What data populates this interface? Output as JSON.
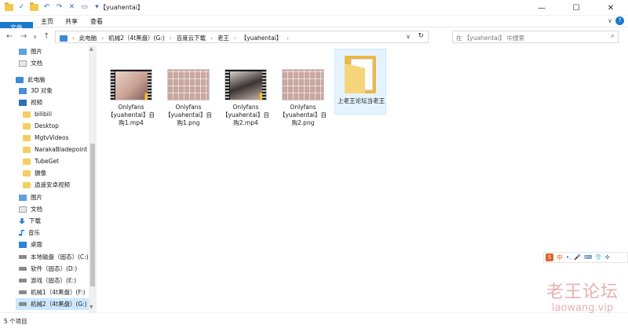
{
  "window": {
    "title": "【yuahentai】",
    "minimize": "—",
    "maximize": "☐",
    "close": "✕"
  },
  "ribbon": {
    "tabs": [
      "文件",
      "主页",
      "共享",
      "查看"
    ],
    "expand": "∨",
    "help": "?"
  },
  "address": {
    "crumbs": [
      "此电脑",
      "机械2（4t黑盘）(G:)",
      "百度云下载",
      "老王",
      "【yuahentai】"
    ],
    "search_placeholder": "在 【yuahentai】 中搜索"
  },
  "nav": {
    "items": [
      {
        "label": "图片",
        "icon": "picture-icon"
      },
      {
        "label": "文档",
        "icon": "document-icon"
      },
      {
        "label": "此电脑",
        "icon": "pc-icon"
      },
      {
        "label": "3D 对象",
        "icon": "3d-objects-icon"
      },
      {
        "label": "视频",
        "icon": "video-icon"
      },
      {
        "label": "bilibili",
        "icon": "folder-icon"
      },
      {
        "label": "Desktop",
        "icon": "folder-icon"
      },
      {
        "label": "MgtvVideos",
        "icon": "folder-icon"
      },
      {
        "label": "NarakaBladepoint",
        "icon": "folder-icon"
      },
      {
        "label": "TubeGet",
        "icon": "folder-icon"
      },
      {
        "label": "摄像",
        "icon": "folder-icon"
      },
      {
        "label": "逍遥安卓视频",
        "icon": "folder-icon"
      },
      {
        "label": "图片",
        "icon": "picture-icon"
      },
      {
        "label": "文档",
        "icon": "document-icon"
      },
      {
        "label": "下载",
        "icon": "download-icon"
      },
      {
        "label": "音乐",
        "icon": "music-icon"
      },
      {
        "label": "桌面",
        "icon": "desktop-icon"
      },
      {
        "label": "本地磁盘（固态）(C:)",
        "icon": "drive-icon"
      },
      {
        "label": "软件（固态）(D:)",
        "icon": "drive-icon"
      },
      {
        "label": "游戏（固态）(E:)",
        "icon": "drive-icon"
      },
      {
        "label": "机械1（4t黑盘）(F:)",
        "icon": "drive-icon"
      },
      {
        "label": "机械2（4t黑盘）(G:)",
        "icon": "drive-icon"
      }
    ]
  },
  "files": [
    {
      "name": "Onlyfans【yuahentai】自购1.mp4",
      "type": "video"
    },
    {
      "name": "Onlyfans【yuahentai】自购1.png",
      "type": "image"
    },
    {
      "name": "Onlyfans【yuahentai】自购2.mp4",
      "type": "video"
    },
    {
      "name": "Onlyfans【yuahentai】自购2.png",
      "type": "image"
    },
    {
      "name": "上老王论坛当老王",
      "type": "folder"
    }
  ],
  "status": {
    "count": "5 个项目"
  },
  "ime": {
    "logo": "S",
    "lang": "中",
    "items": [
      "•,",
      "🎤",
      "⌨",
      "👕",
      "✣"
    ]
  },
  "watermark": {
    "line1": "老王论坛",
    "line2": "laowang.vip"
  }
}
